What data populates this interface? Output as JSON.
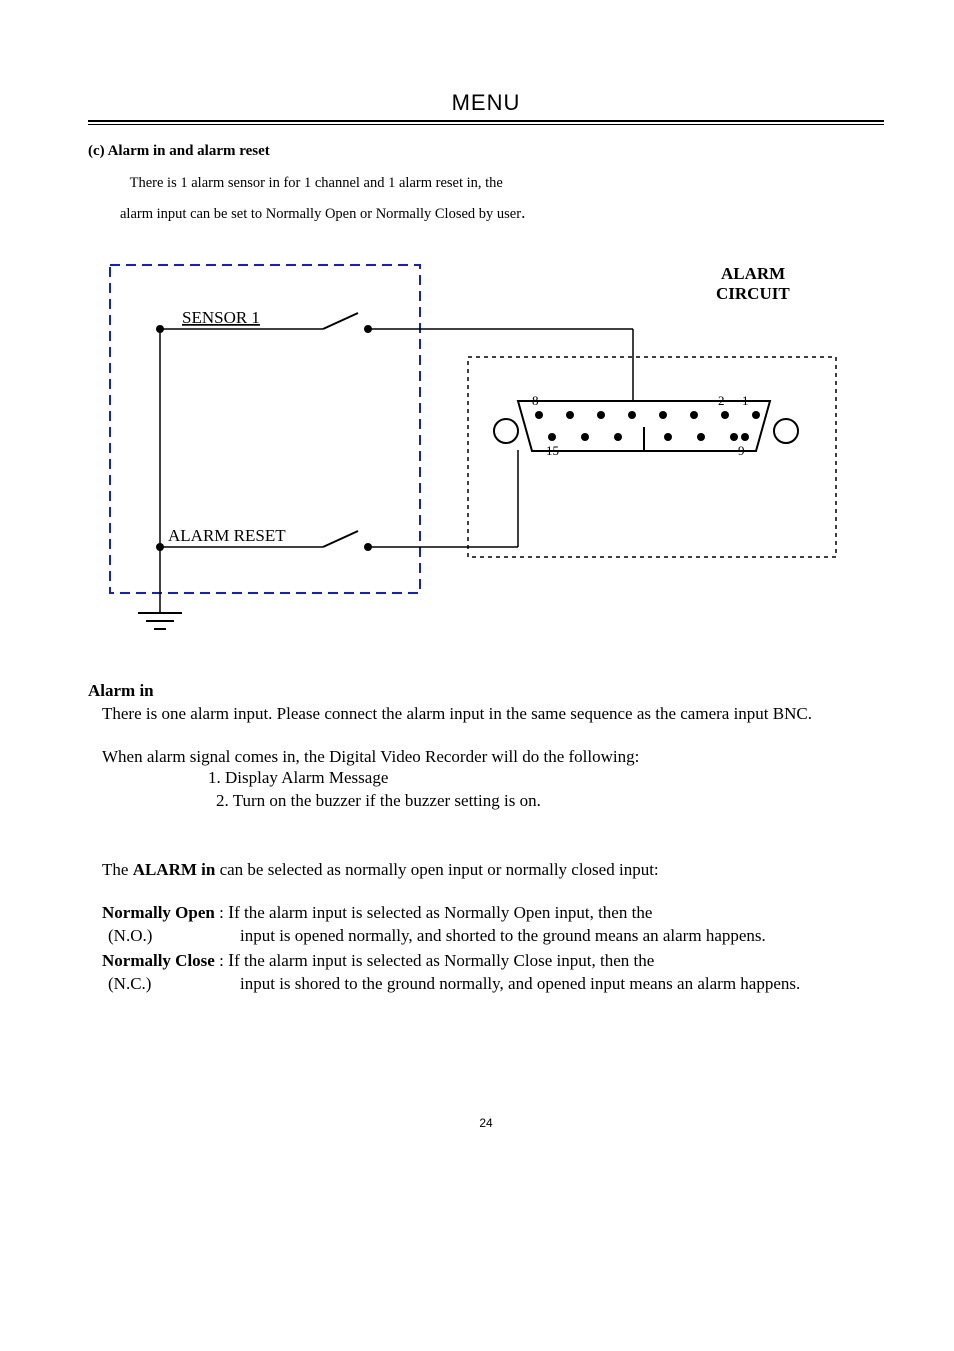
{
  "header": {
    "title": "MENU"
  },
  "subsection": {
    "title": "(c) Alarm in and alarm reset"
  },
  "intro": {
    "line1": "There is 1 alarm sensor in for 1 channel and 1 alarm reset in, the",
    "line2_pre": "alarm input can be set to Normally Open or Normally Closed by user",
    "line2_period": "."
  },
  "diagram": {
    "alarm_circuit_label_1": "ALARM",
    "alarm_circuit_label_2": "CIRCUIT",
    "sensor_label": "SENSOR 1",
    "alarm_reset_label": "ALARM RESET",
    "connector_pins": {
      "tl": "8",
      "tr1": "2",
      "tr2": "1",
      "bl": "15",
      "br": "9"
    }
  },
  "alarm_in": {
    "heading": "Alarm in",
    "p1": "There is one alarm input.  Please connect the alarm  input in the same sequence as the camera input BNC.",
    "p2": "When alarm signal comes in, the Digital Video Recorder  will do the following:",
    "enum1": "1. Display Alarm Message",
    "enum2": "2. Turn on the buzzer if the buzzer setting is on.",
    "p3_pre": "The ",
    "p3_bold": "ALARM in",
    "p3_post": " can be selected as normally open input or normally closed input:"
  },
  "terms": {
    "no": {
      "term_bold": "Normally Open",
      "term_post": " : ",
      "first_line_tail": "f the alarm input is selected as Normally Open input, then the",
      "abbrev": "(N.O.)",
      "second_line": "input is opened normally, and shorted to the ground means an alarm happens."
    },
    "nc": {
      "term_bold": "Normally Close",
      "term_post": " : ",
      "first_line_tail": "f the alarm input is selected as Normally Close input, then the",
      "abbrev": "(N.C.)",
      "second_line": "input is shored to the ground normally, and opened input means an  alarm happens."
    }
  },
  "footer": {
    "page_number": "24"
  }
}
